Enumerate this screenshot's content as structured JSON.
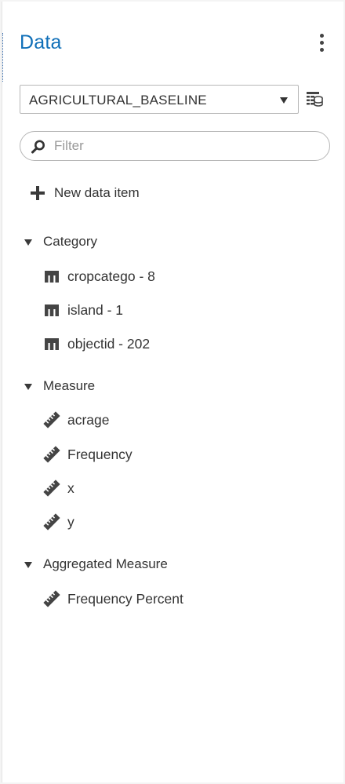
{
  "panel": {
    "title": "Data",
    "more_icon": "kebab-vertical-icon"
  },
  "data_source": {
    "selected": "AGRICULTURAL_BASELINE",
    "details_icon": "data-source-details-icon"
  },
  "filter": {
    "placeholder": "Filter",
    "value": ""
  },
  "new_data_item": {
    "label": "New data item"
  },
  "sections": {
    "category": {
      "label": "Category",
      "expanded": true,
      "items": [
        {
          "label": "cropcatego - 8",
          "icon": "category-icon"
        },
        {
          "label": "island - 1",
          "icon": "category-icon"
        },
        {
          "label": "objectid - 202",
          "icon": "category-icon"
        }
      ]
    },
    "measure": {
      "label": "Measure",
      "expanded": true,
      "items": [
        {
          "label": "acrage",
          "icon": "measure-ruler-icon"
        },
        {
          "label": "Frequency",
          "icon": "measure-ruler-icon"
        },
        {
          "label": "x",
          "icon": "measure-ruler-icon"
        },
        {
          "label": "y",
          "icon": "measure-ruler-icon"
        }
      ]
    },
    "aggregated": {
      "label": "Aggregated Measure",
      "expanded": true,
      "items": [
        {
          "label": "Frequency Percent",
          "icon": "measure-ruler-icon"
        }
      ]
    }
  },
  "colors": {
    "title": "#0f6fb8",
    "text": "#333333",
    "icon": "#444444",
    "border": "#b7b7b7"
  }
}
